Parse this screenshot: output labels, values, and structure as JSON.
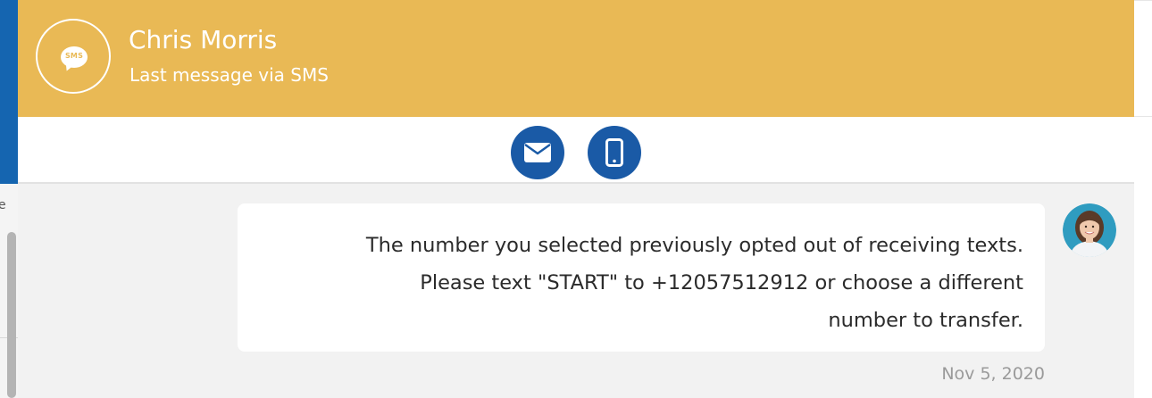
{
  "header": {
    "contact_name": "Chris Morris",
    "subtitle": "Last message via SMS",
    "channel_badge": "SMS",
    "channel_icon": "sms-bubble-icon",
    "background_color": "#e9b955"
  },
  "actions": [
    {
      "name": "email",
      "icon": "envelope-icon"
    },
    {
      "name": "sms",
      "icon": "mobile-phone-icon"
    }
  ],
  "conversation": {
    "messages": [
      {
        "lines": [
          "The number you selected previously opted out of receiving texts.",
          "Please text \"START\" to +12057512912 or choose a different",
          "number to transfer."
        ],
        "timestamp": "Nov 5, 2020",
        "sender_avatar": "agent-avatar"
      }
    ]
  },
  "colors": {
    "action_button": "#1a5aa6",
    "side_bar": "#1565b0",
    "conversation_bg": "#f2f2f2"
  },
  "background_app": {
    "edge_glyph": "e"
  }
}
